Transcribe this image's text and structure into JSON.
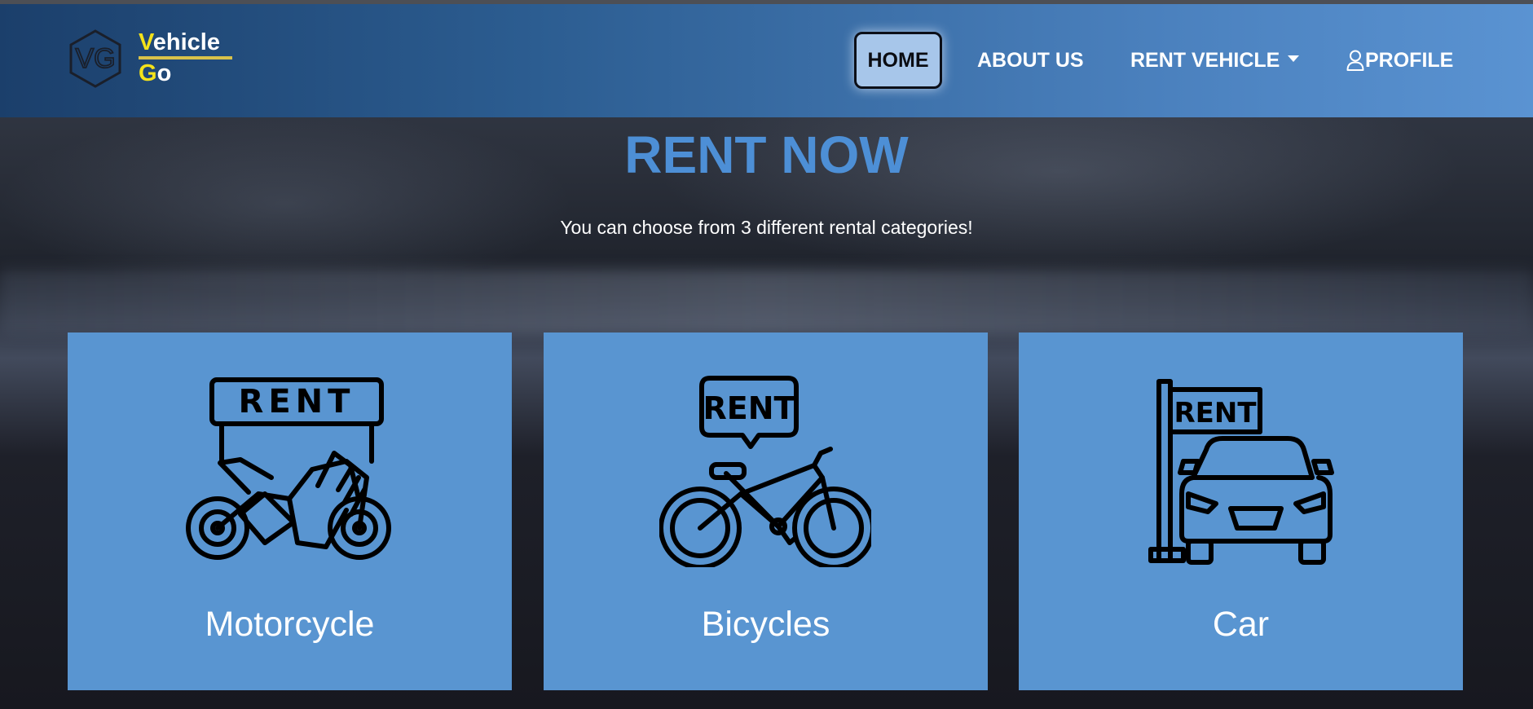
{
  "brand": {
    "logo_initials": "VG",
    "line1_cap": "V",
    "line1_rest": "ehicle",
    "line2_cap": "G",
    "line2_rest": "o"
  },
  "nav": {
    "home": "HOME",
    "about": "ABOUT US",
    "rent_vehicle": "RENT VEHICLE",
    "profile": "PROFILE"
  },
  "hero": {
    "title": "RENT NOW",
    "subtitle": "You can choose from 3 different rental categories!"
  },
  "cards": [
    {
      "label": "Motorcycle",
      "sign": "RENT",
      "icon": "motorcycle-rent-icon"
    },
    {
      "label": "Bicycles",
      "sign": "RENT",
      "icon": "bicycle-rent-icon"
    },
    {
      "label": "Car",
      "sign": "RENT",
      "icon": "car-rent-icon"
    }
  ],
  "colors": {
    "accent": "#5995d1",
    "title": "#4d8fd6",
    "logo_yellow": "#f4e21a"
  }
}
